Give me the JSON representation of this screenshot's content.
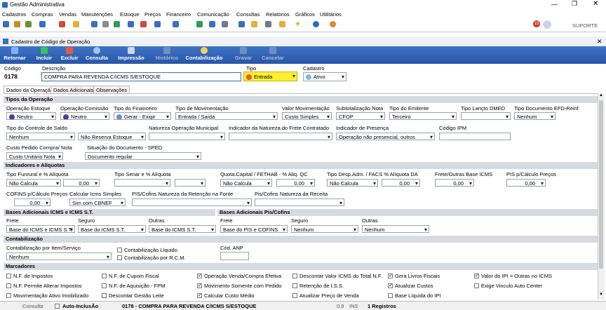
{
  "window": {
    "title": "Gestão Administrativa"
  },
  "menu": [
    "Cadastros",
    "Compras",
    "Vendas",
    "Manutenções",
    "Estoque",
    "Preços",
    "Financeiro",
    "Comunicação",
    "Consultas",
    "Relatórios",
    "Gráficos",
    "Utilitários"
  ],
  "toolbar": {
    "support_label": "SUPORTE",
    "badge_count": "15"
  },
  "form": {
    "title": "Cadastro de Código de Operação",
    "buttons": {
      "retornar": "Retornar",
      "incluir": "Incluir",
      "excluir": "Excluir",
      "consulta": "Consulta",
      "impressao": "Impressão",
      "historico": "Histórico",
      "contabilizacao": "Contabilização",
      "gravar": "Gravar",
      "cancelar": "Cancelar"
    },
    "codigo_label": "Código",
    "codigo_value": "0178",
    "descricao_label": "Descrição",
    "descricao_value": "COMPRA PARA REVENDA C/ICMS S/ESTOQUE",
    "tipo_label": "Tipo",
    "tipo_value": "Entrada",
    "cadastro_label": "Cadastro",
    "cadastro_value": "Ativo",
    "tabs": [
      "Dados da Operação",
      "Dados Adicionais",
      "Observações"
    ]
  },
  "tipos": {
    "section": "Tipos da Operação",
    "operacao_estoque": {
      "label": "Operação Estoque",
      "value": "Neutro"
    },
    "operacao_comissao": {
      "label": "Operação Comissão",
      "value": "Neutro"
    },
    "tipo_financeiro": {
      "label": "Tipo do Financeiro",
      "value": "Gerar - Exigir"
    },
    "tipo_movimentacao": {
      "label": "Tipo de Movimentação",
      "value": "Entrada / Saída"
    },
    "valor_movimentacao": {
      "label": "Valor Movimentação",
      "value": "Custo Simples"
    },
    "subtotalizacao": {
      "label": "Subtotalização Nota",
      "value": "CFOP"
    },
    "tipo_emitente": {
      "label": "Tipo do Emitente",
      "value": "Terceiro"
    },
    "tipo_lancto": {
      "label": "Tipo Lançto DMED",
      "value": ""
    },
    "tipo_doc_efd": {
      "label": "Tipo Documento EFD-Reinf",
      "value": "Nenhum"
    },
    "controle_saldo": {
      "label": "Tipo do Controle de Saldo",
      "value": "Nenhum"
    },
    "reserva": {
      "label": "",
      "value": "Não Reserva Estoque"
    },
    "natureza_mun": {
      "label": "Natureza Operação Municipal",
      "value": ""
    },
    "indicador_natureza": {
      "label": "Indicador da Natureza do Frete Contratado",
      "value": ""
    },
    "indicador_presenca": {
      "label": "Indicador de Presença",
      "value": "Operação não presencial, outros"
    },
    "codigo_ipm": {
      "label": "Código IPM",
      "value": ""
    },
    "custo_pedido": {
      "label": "Custo Pedido Compra/ Nota",
      "value": "Custo Unitário Nota"
    },
    "situacao_doc": {
      "label": "Situação do Documento - SPED",
      "value": "Documento regular"
    }
  },
  "indicadores": {
    "section": "Indicadores e Alíquotas",
    "funrural": {
      "label": "Tipo Funrural e % Alíquota",
      "value": "Não Calcula",
      "pct": "0,00"
    },
    "senar": {
      "label": "Tipo Senar e % Alíquota",
      "value": "",
      "pct": ""
    },
    "quota": {
      "label": "Quota.Capital / FETHAB - % Aliq. QC",
      "value": "Não Calcula",
      "pct": "0,00"
    },
    "desp_adm": {
      "label": "Tipo Desp.Adm. / FACS % Alíquota DA",
      "value": "Não Calcula",
      "pct": "0,00"
    },
    "frete_outras": {
      "label": "Frete/Outras Base ICMS",
      "value": "0,00"
    },
    "pis": {
      "label": "PIS p/Cálculo Preços",
      "value": "0,00"
    },
    "cofins": {
      "label": "COFINS p/Cálculo Preços",
      "value": "0,00"
    },
    "icms_simples": {
      "label": "Calcular Icms Simples",
      "value": "Sim com CBNEF"
    },
    "pis_cofins_ret": {
      "label": "PIS/Cofins Natureza da Retenção na Fonte",
      "value": ""
    },
    "pis_cofins_rec": {
      "label": "Pis/Cofins Natureza da Receita",
      "value": ""
    }
  },
  "bases": {
    "icms_section": "Bases Adicionais ICMS e ICMS S.T.",
    "pis_section": "Bases Adicionais Pis/Cofins",
    "frete_label": "Frete",
    "seguro_label": "Seguro",
    "outras_label": "Outras",
    "icms_frete": "Base do ICMS e ICMS S.T.",
    "icms_seguro": "Base do ICMS S.T.",
    "icms_outras": "Base do ICMS S.T.",
    "pis_frete": "Base do PIS e COFINS",
    "pis_seguro": "Nenhum",
    "pis_outras": "Nenhum"
  },
  "contab": {
    "section": "Contabilização",
    "por_item_label": "Contabilização por Item/Serviço",
    "por_item_value": "Nenhum",
    "liquido_label": "Contabilização Líquido",
    "rcm_label": "Contabilização por R.C.M.",
    "cod_anp_label": "Cód. ANP"
  },
  "marcadores": {
    "section": "Marcadores",
    "items": [
      {
        "label": "N.F. de Impostos",
        "checked": false
      },
      {
        "label": "N.F. Permite Alterar Impostos",
        "checked": false
      },
      {
        "label": "Movimentação Ativo Imobilizado",
        "checked": false
      },
      {
        "label": "N.F. de Cupom Fiscal",
        "checked": false
      },
      {
        "label": "N.F. de Aquisição - FPM",
        "checked": false
      },
      {
        "label": "Descontar Gestão Leite",
        "checked": false
      },
      {
        "label": "Operação Venda/Compra Efetiva",
        "checked": true
      },
      {
        "label": "Movimento Somente com Pedido",
        "checked": true
      },
      {
        "label": "Calcular Custo Médio",
        "checked": true
      },
      {
        "label": "Descontar Valor ICMS do Total N.F.",
        "checked": false
      },
      {
        "label": "Retenção de I.S.S.",
        "checked": false
      },
      {
        "label": "Atualizar Preço de Venda",
        "checked": false
      },
      {
        "label": "Gera Livros Fiscais",
        "checked": true
      },
      {
        "label": "Atualizar Custos",
        "checked": true
      },
      {
        "label": "Base Líquida do IPI",
        "checked": false
      },
      {
        "label": "Valor do IPI = Outras no ICMS",
        "checked": true
      },
      {
        "label": "Exige Vinculo Auto Center",
        "checked": false
      }
    ]
  },
  "status": {
    "mode": "Consulta",
    "auto_inclusao": "Auto-InclusÃo",
    "record": "0178 - COMPRA PARA REVENDA C/ICMS S/ESTOQUE",
    "version": "0.9",
    "ins": "INS",
    "count": "1 Registros"
  },
  "colors": {
    "accent": "#2756a6",
    "tipo_highlight": "#ffee33"
  }
}
